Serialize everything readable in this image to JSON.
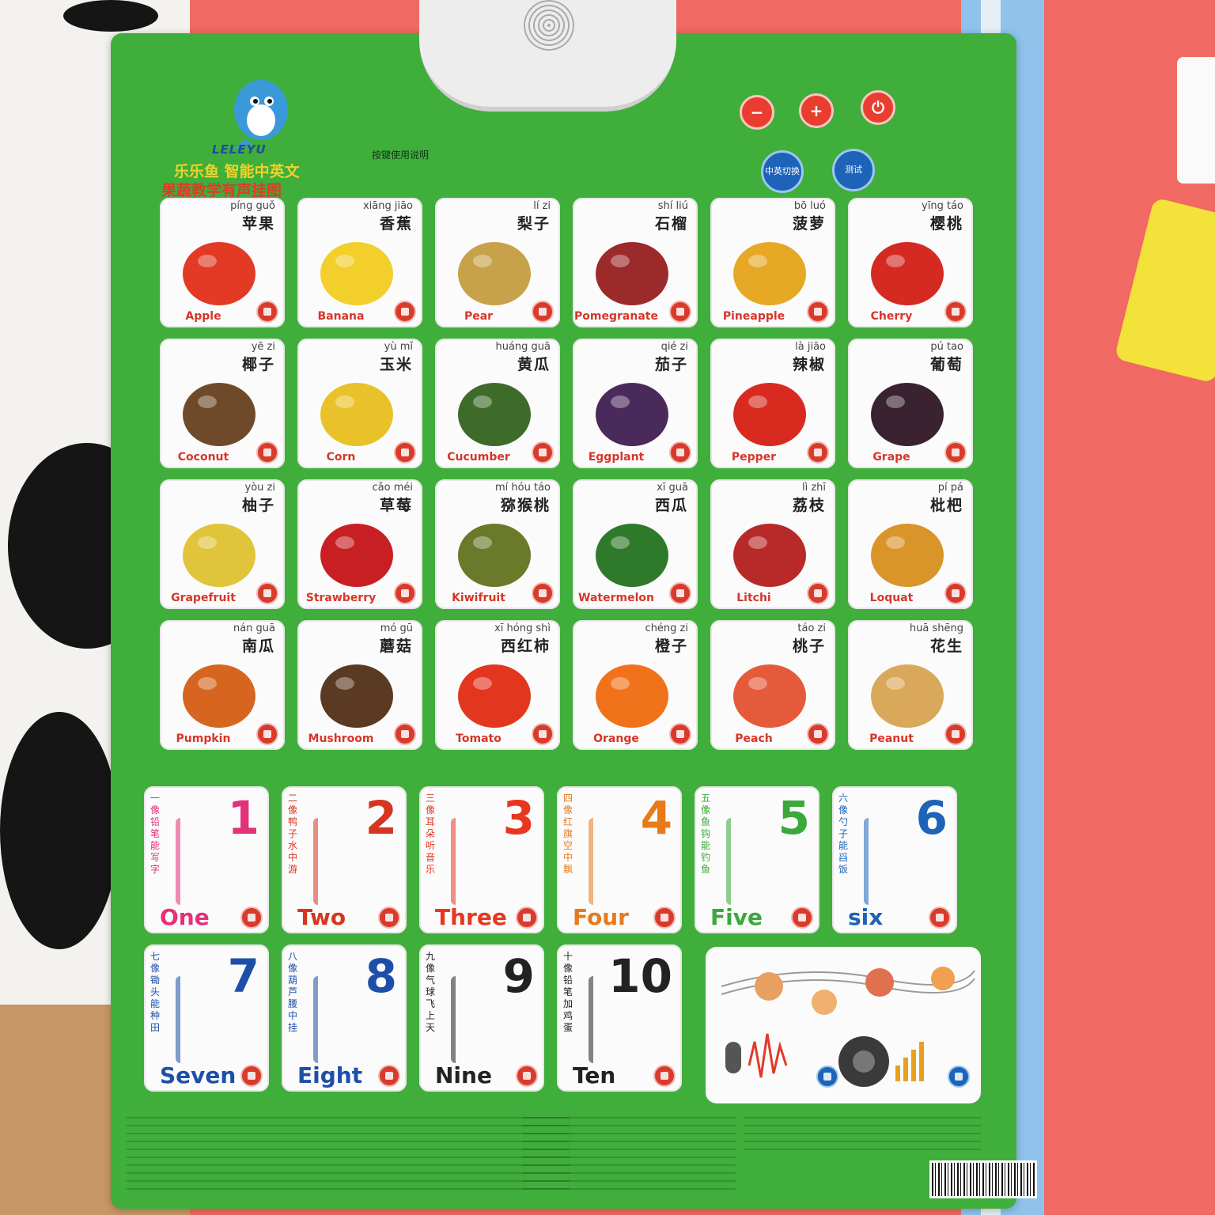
{
  "poster": {
    "brand_en": "LELEYU",
    "title_line1": "乐乐鱼 智能中英文",
    "title_line2": "果蔬教学有声挂图",
    "instructions_heading": "按键使用说明",
    "controls": {
      "vol_down": "−",
      "vol_up": "+",
      "power": "⏻",
      "switch_lang": "中英切换",
      "test": "测试"
    }
  },
  "cards": [
    {
      "pinyin": "píng guǒ",
      "zh": "苹果",
      "en": "Apple",
      "color": "#e23a24"
    },
    {
      "pinyin": "xiāng jiāo",
      "zh": "香蕉",
      "en": "Banana",
      "color": "#f2cf2a"
    },
    {
      "pinyin": "lí zi",
      "zh": "梨子",
      "en": "Pear",
      "color": "#c8a24a"
    },
    {
      "pinyin": "shí liú",
      "zh": "石榴",
      "en": "Pomegranate",
      "color": "#9c2a2a"
    },
    {
      "pinyin": "bō luó",
      "zh": "菠萝",
      "en": "Pineapple",
      "color": "#e6a825"
    },
    {
      "pinyin": "yīng táo",
      "zh": "樱桃",
      "en": "Cherry",
      "color": "#d42a22"
    },
    {
      "pinyin": "yē zi",
      "zh": "椰子",
      "en": "Coconut",
      "color": "#6e4a2a"
    },
    {
      "pinyin": "yù mǐ",
      "zh": "玉米",
      "en": "Corn",
      "color": "#e9c22a"
    },
    {
      "pinyin": "huáng guā",
      "zh": "黄瓜",
      "en": "Cucumber",
      "color": "#3e6a2a"
    },
    {
      "pinyin": "qié zi",
      "zh": "茄子",
      "en": "Eggplant",
      "color": "#4a2a5a"
    },
    {
      "pinyin": "là jiāo",
      "zh": "辣椒",
      "en": "Pepper",
      "color": "#d82a1f"
    },
    {
      "pinyin": "pú tao",
      "zh": "葡萄",
      "en": "Grape",
      "color": "#3a2230"
    },
    {
      "pinyin": "yòu zi",
      "zh": "柚子",
      "en": "Grapefruit",
      "color": "#e0c43a"
    },
    {
      "pinyin": "cǎo méi",
      "zh": "草莓",
      "en": "Strawberry",
      "color": "#c81f24"
    },
    {
      "pinyin": "mí hóu táo",
      "zh": "猕猴桃",
      "en": "Kiwifruit",
      "color": "#6a7a2a"
    },
    {
      "pinyin": "xī guā",
      "zh": "西瓜",
      "en": "Watermelon",
      "color": "#2f7a2a"
    },
    {
      "pinyin": "lì zhī",
      "zh": "荔枝",
      "en": "Litchi",
      "color": "#b82a2a"
    },
    {
      "pinyin": "pí pá",
      "zh": "枇杷",
      "en": "Loquat",
      "color": "#d9942a"
    },
    {
      "pinyin": "nán guā",
      "zh": "南瓜",
      "en": "Pumpkin",
      "color": "#d6661f"
    },
    {
      "pinyin": "mó gū",
      "zh": "蘑菇",
      "en": "Mushroom",
      "color": "#5a3a22"
    },
    {
      "pinyin": "xī hóng shì",
      "zh": "西红柿",
      "en": "Tomato",
      "color": "#e2361f"
    },
    {
      "pinyin": "chéng zi",
      "zh": "橙子",
      "en": "Orange",
      "color": "#f0721a"
    },
    {
      "pinyin": "táo zi",
      "zh": "桃子",
      "en": "Peach",
      "color": "#e55a3a"
    },
    {
      "pinyin": "huā shēng",
      "zh": "花生",
      "en": "Peanut",
      "color": "#d9a85a"
    }
  ],
  "numbers": [
    {
      "num": "1",
      "en": "One",
      "desc": "一像铅笔能写字",
      "color": "#e5307a"
    },
    {
      "num": "2",
      "en": "Two",
      "desc": "二像鸭子水中游",
      "color": "#d6361f"
    },
    {
      "num": "3",
      "en": "Three",
      "desc": "三像耳朵听音乐",
      "color": "#e8361f"
    },
    {
      "num": "4",
      "en": "Four",
      "desc": "四像红旗空中飘",
      "color": "#e87a1a"
    },
    {
      "num": "5",
      "en": "Five",
      "desc": "五像鱼钩能钓鱼",
      "color": "#3aa83a"
    },
    {
      "num": "6",
      "en": "six",
      "desc": "六像勺子能舀饭",
      "color": "#1d63b8"
    },
    {
      "num": "7",
      "en": "Seven",
      "desc": "七像锄头能种田",
      "color": "#1d4fa8"
    },
    {
      "num": "8",
      "en": "Eight",
      "desc": "八像葫芦腰中挂",
      "color": "#1d4fa8"
    },
    {
      "num": "9",
      "en": "Nine",
      "desc": "九像气球飞上天",
      "color": "#222222"
    },
    {
      "num": "10",
      "en": "Ten",
      "desc": "十像铅笔加鸡蛋",
      "color": "#222222"
    }
  ]
}
